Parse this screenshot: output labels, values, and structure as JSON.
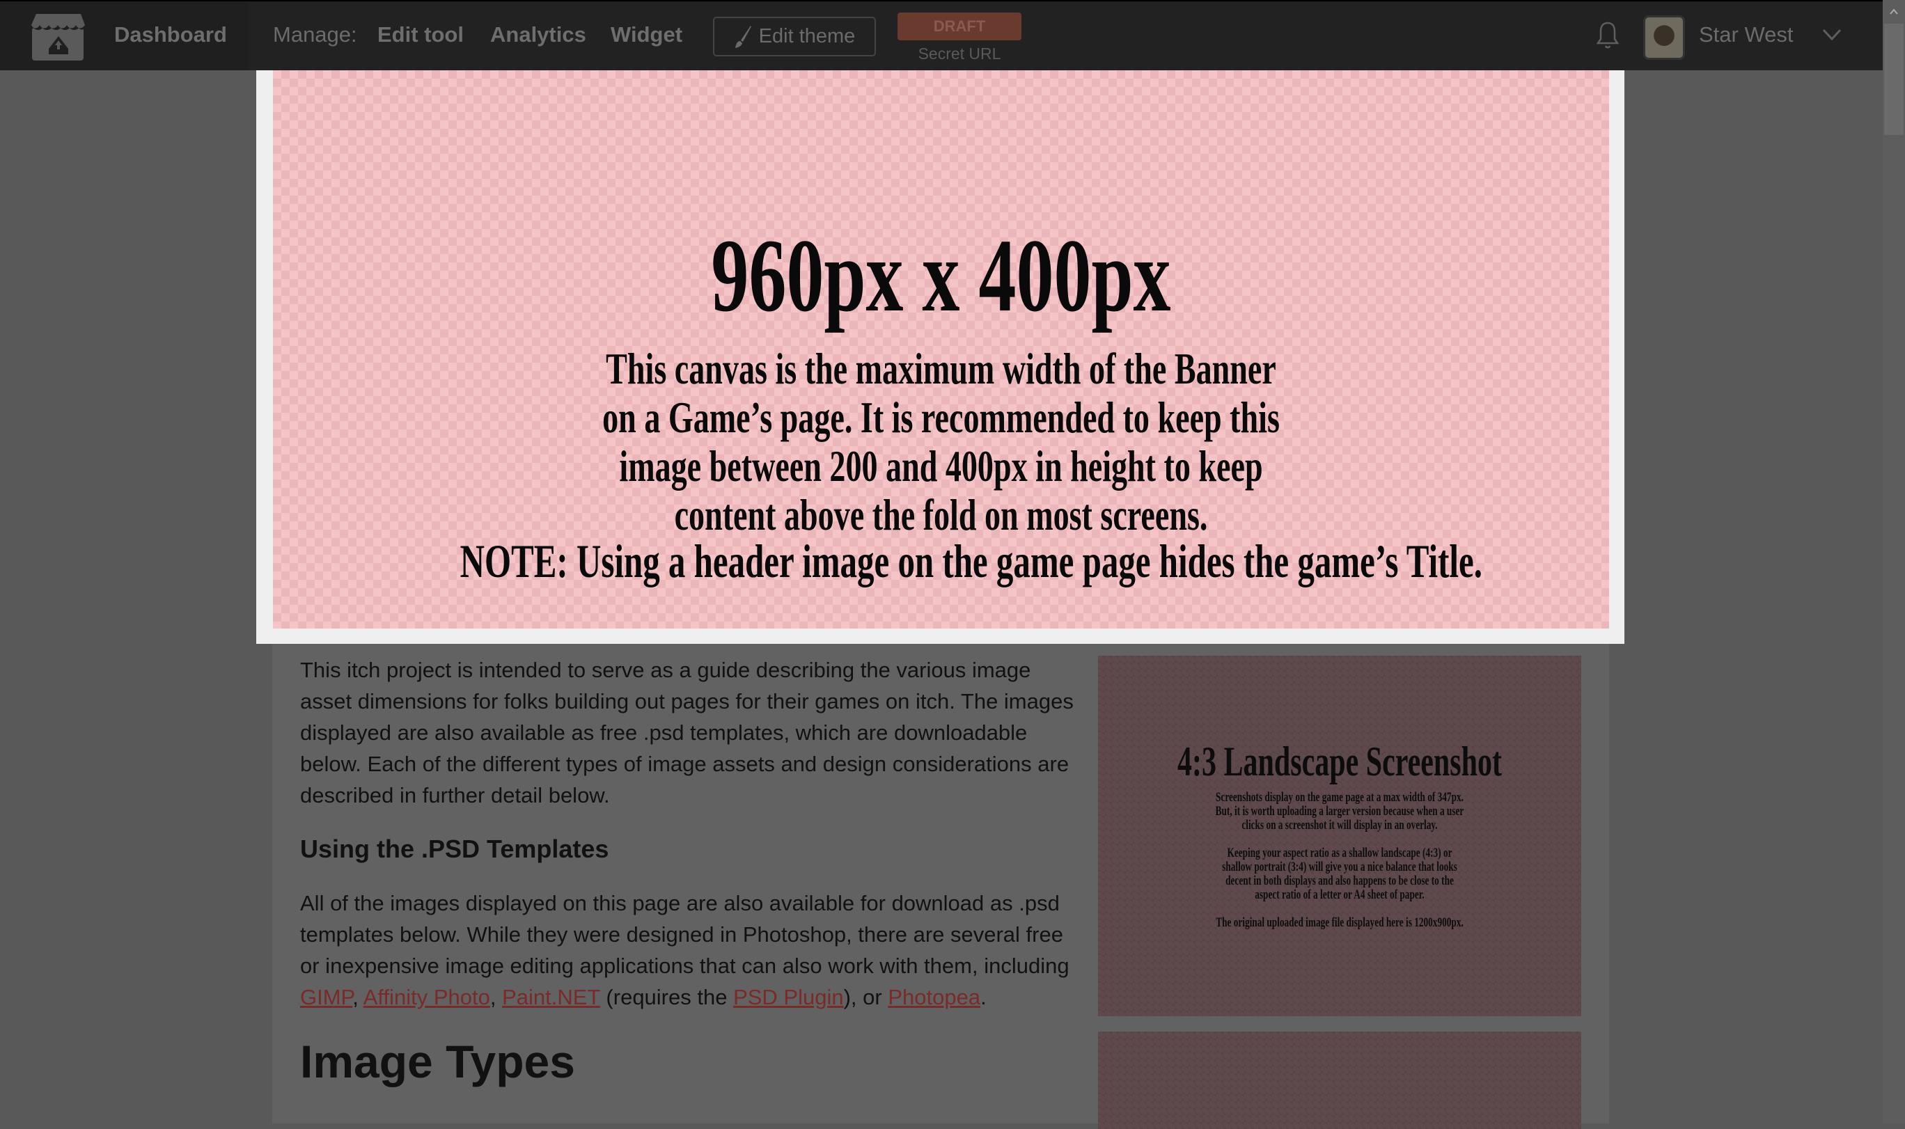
{
  "header": {
    "dashboard": "Dashboard",
    "manage_label": "Manage:",
    "edit_tool": "Edit tool",
    "analytics": "Analytics",
    "widget": "Widget",
    "edit_theme": "Edit theme",
    "draft": "DRAFT",
    "secret_url": "Secret URL",
    "username": "Star West"
  },
  "banner": {
    "title": "960px x 400px",
    "lines": [
      "This canvas is the maximum width of the  Banner",
      "on a Game’s page. It is recommended to keep this",
      "image between 200 and 400px in height to keep",
      "content above the fold on most screens."
    ],
    "note": "NOTE: Using a header image on the game page hides the game’s Title."
  },
  "body": {
    "intro": "This itch project is intended to serve as a guide describing the various image asset dimensions for folks building out pages for their games on itch. The images displayed are also available as free .psd templates, which are downloadable below. Each of the different types of image assets and design considerations are described in further detail below.",
    "h_psd": "Using the .PSD Templates",
    "psd_text": "All of the images displayed on this page are also available for download as .psd templates below. While they were designed in Photoshop, there are several free or inexpensive image editing applications that can also work with them, including ",
    "links": {
      "gimp": "GIMP",
      "affinity": "Affinity Photo",
      "paintnet": "Paint.NET",
      "psd_plugin": "PSD Plugin",
      "photopea": "Photopea"
    },
    "sep1": ", ",
    "sep2": ", ",
    "req": " (requires the ",
    "after": "), or ",
    "end": ".",
    "h_types": "Image Types"
  },
  "screenshot": {
    "title": "4:3 Landscape Screenshot",
    "p1": [
      "Screenshots display on the game page at a max width of 347px.",
      "But, it is worth uploading a larger version because when a user",
      "clicks on a screenshot it will display in an overlay."
    ],
    "p2": [
      "Keeping your aspect ratio as a shallow landscape (4:3) or",
      "shallow portrait (3:4) will give you a nice balance that looks",
      "decent in both displays and also happens to be close to the",
      "aspect ratio of a letter or A4 sheet of paper."
    ],
    "p3": "The original uploaded image file displayed here is 1200x900px."
  }
}
